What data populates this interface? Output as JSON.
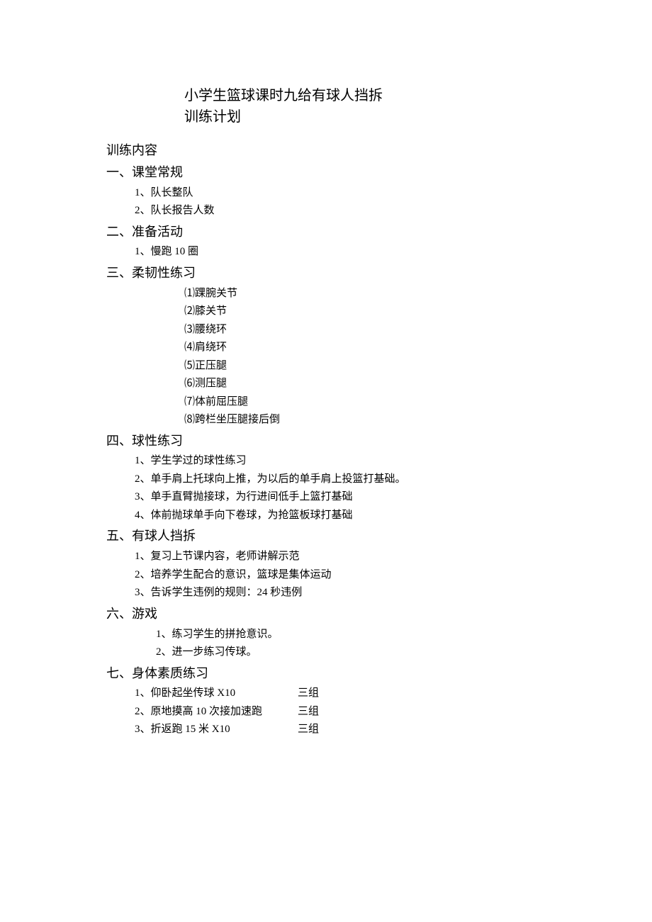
{
  "title": {
    "line1": "小学生篮球课时九给有球人挡拆",
    "line2": "训练计划"
  },
  "contentHeading": "训练内容",
  "sections": {
    "s1": {
      "heading": "一、课堂常规",
      "items": [
        "1、队长整队",
        "2、队长报告人数"
      ]
    },
    "s2": {
      "heading": "二、准备活动",
      "items": [
        "1、慢跑 10 圈"
      ]
    },
    "s3": {
      "heading": "三、柔韧性练习",
      "items": [
        "⑴踝腕关节",
        "⑵膝关节",
        "⑶腰绕环",
        "⑷肩绕环",
        "⑸正压腿",
        "⑹测压腿",
        "⑺体前屈压腿",
        "⑻跨栏坐压腿接后倒"
      ]
    },
    "s4": {
      "heading": "四、球性练习",
      "items": [
        "1、学生学过的球性练习",
        "2、单手肩上托球向上推，为以后的单手肩上投篮打基础。",
        "3、单手直臂抛接球，为行进间低手上篮打基础",
        "4、体前抛球单手向下卷球，为抢篮板球打基础"
      ]
    },
    "s5": {
      "heading": "五、有球人挡拆",
      "items": [
        "1、复习上节课内容，老师讲解示范",
        "2、培养学生配合的意识，篮球是集体运动",
        "3、告诉学生违例的规则：24 秒违例"
      ]
    },
    "s6": {
      "heading": "六、游戏",
      "items": [
        "1、练习学生的拼抢意识。",
        "2、进一步练习传球。"
      ]
    },
    "s7": {
      "heading": "七、身体素质练习",
      "rows": [
        {
          "left": "1、仰卧起坐传球 X10",
          "right": "三组"
        },
        {
          "left": "2、原地摸高 10 次接加速跑",
          "right": "三组"
        },
        {
          "left": "3、折返跑 15 米 X10",
          "right": "三组"
        }
      ]
    }
  }
}
